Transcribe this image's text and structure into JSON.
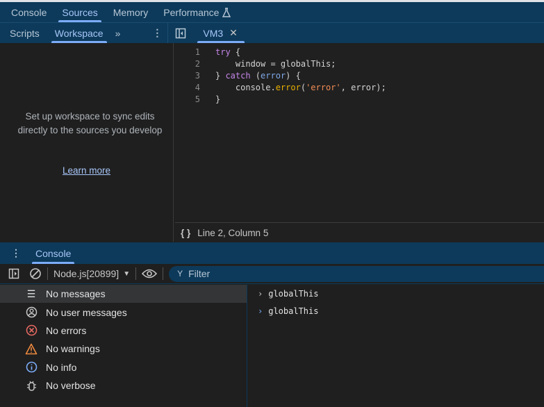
{
  "main_tabs": [
    {
      "label": "Console"
    },
    {
      "label": "Sources"
    },
    {
      "label": "Memory"
    },
    {
      "label": "Performance"
    }
  ],
  "sources_tabs": [
    {
      "label": "Scripts"
    },
    {
      "label": "Workspace"
    }
  ],
  "file_tab": {
    "label": "VM3"
  },
  "workspace": {
    "message": "Set up workspace to sync edits directly to the sources you develop",
    "link": "Learn more"
  },
  "code_lines": [
    "1",
    "2",
    "3",
    "4",
    "5"
  ],
  "code": {
    "l1_kw": "try",
    "l1_rest": " {",
    "l2": "    window = globalThis;",
    "l3_a": "} ",
    "l3_kw": "catch",
    "l3_b": " (",
    "l3_var": "error",
    "l3_c": ") {",
    "l4_a": "    console.",
    "l4_fn": "error",
    "l4_b": "(",
    "l4_str": "'error'",
    "l4_c": ", error);",
    "l5": "}"
  },
  "status": {
    "position": "Line 2, Column 5"
  },
  "drawer": {
    "tab": "Console",
    "context": "Node.js[20899]",
    "filter_placeholder": "Filter"
  },
  "sidebar": [
    {
      "label": "No messages",
      "icon": "list-icon"
    },
    {
      "label": "No user messages",
      "icon": "user-icon"
    },
    {
      "label": "No errors",
      "icon": "error-icon"
    },
    {
      "label": "No warnings",
      "icon": "warning-icon"
    },
    {
      "label": "No info",
      "icon": "info-icon"
    },
    {
      "label": "No verbose",
      "icon": "bug-icon"
    }
  ],
  "messages": [
    {
      "text": "globalThis"
    },
    {
      "text": "globalThis"
    }
  ],
  "colors": {
    "accent": "#7cacf8",
    "toolbar_bg": "#0d3a5a",
    "error": "#e46962",
    "warning": "#f08a3e",
    "info": "#7cacf8"
  }
}
